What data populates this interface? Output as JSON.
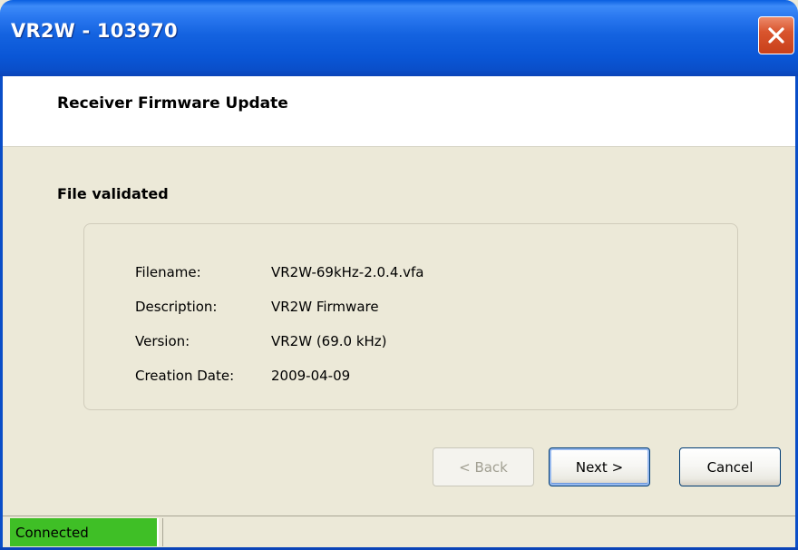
{
  "window": {
    "title": "VR2W - 103970"
  },
  "header": {
    "title": "Receiver Firmware Update"
  },
  "body": {
    "section_title": "File validated",
    "fields": [
      {
        "label": "Filename:",
        "value": "VR2W-69kHz-2.0.4.vfa"
      },
      {
        "label": "Description:",
        "value": "VR2W Firmware"
      },
      {
        "label": "Version:",
        "value": "VR2W (69.0 kHz)"
      },
      {
        "label": "Creation Date:",
        "value": "2009-04-09"
      }
    ]
  },
  "buttons": {
    "back_label": "< Back",
    "back_enabled": false,
    "next_label": "Next >",
    "cancel_label": "Cancel"
  },
  "statusbar": {
    "status_text": "Connected",
    "status_color": "#3fbf26"
  },
  "icons": {
    "close": "close-icon"
  }
}
